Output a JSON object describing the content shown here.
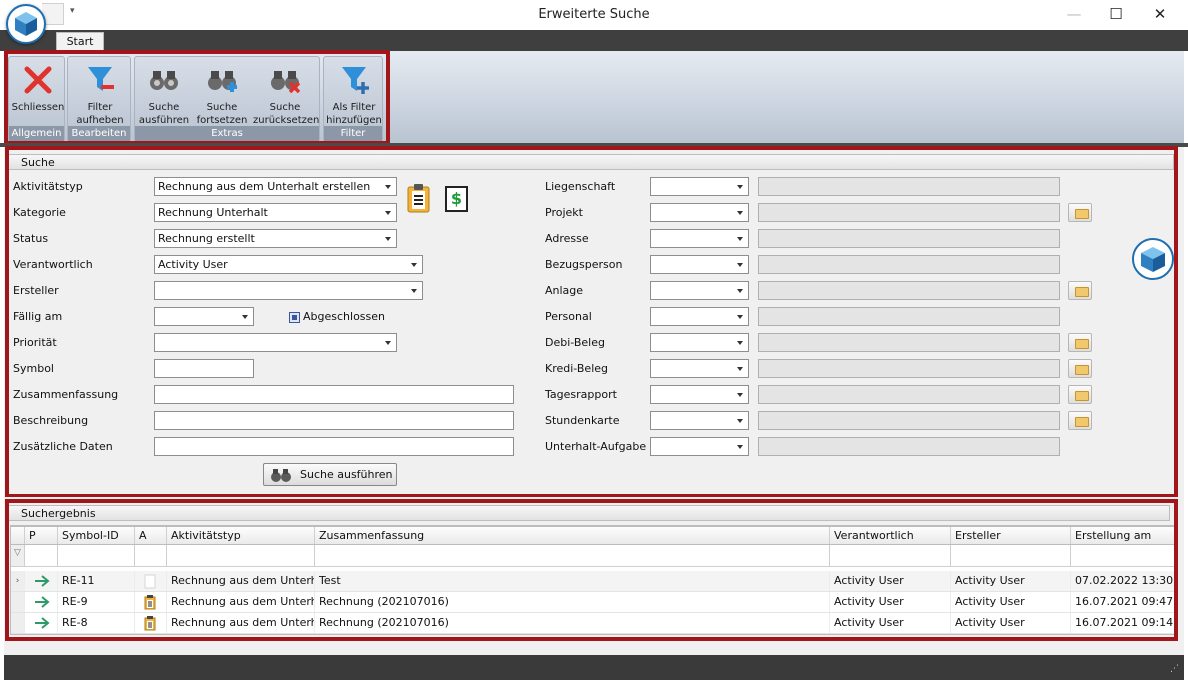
{
  "window": {
    "title": "Erweiterte Suche",
    "minimize": "—",
    "maximize": "☐",
    "close": "✕",
    "qat_dropdown": "▾"
  },
  "ribbon": {
    "tab": "Start",
    "groups": [
      {
        "caption": "Allgemein",
        "buttons": [
          {
            "label1": "Schliessen",
            "label2": "",
            "icon": "close-icon"
          }
        ]
      },
      {
        "caption": "Bearbeiten",
        "buttons": [
          {
            "label1": "Filter",
            "label2": "aufheben",
            "icon": "filter-remove-icon"
          }
        ]
      },
      {
        "caption": "Extras",
        "buttons": [
          {
            "label1": "Suche",
            "label2": "ausführen",
            "icon": "binoculars-icon"
          },
          {
            "label1": "Suche",
            "label2": "fortsetzen",
            "icon": "binoculars-plus-icon"
          },
          {
            "label1": "Suche",
            "label2": "zurücksetzen",
            "icon": "binoculars-x-icon"
          }
        ]
      },
      {
        "caption": "Filter",
        "buttons": [
          {
            "label1": "Als Filter",
            "label2": "hinzufügen",
            "icon": "filter-add-icon"
          }
        ]
      }
    ]
  },
  "suche": {
    "header": "Suche",
    "left": [
      {
        "label": "Aktivitätstyp",
        "value": "Rechnung aus dem Unterhalt erstellen"
      },
      {
        "label": "Kategorie",
        "value": "Rechnung Unterhalt"
      },
      {
        "label": "Status",
        "value": "Rechnung erstellt"
      },
      {
        "label": "Verantwortlich",
        "value": "Activity User"
      },
      {
        "label": "Ersteller",
        "value": ""
      },
      {
        "label": "Fällig am",
        "value": ""
      },
      {
        "label": "Priorität",
        "value": ""
      },
      {
        "label": "Symbol",
        "value": ""
      },
      {
        "label": "Zusammenfassung",
        "value": ""
      },
      {
        "label": "Beschreibung",
        "value": ""
      },
      {
        "label": "Zusätzliche Daten",
        "value": ""
      }
    ],
    "abgeschlossen_label": "Abgeschlossen",
    "dollar_symbol": "$",
    "right": [
      {
        "label": "Liegenschaft"
      },
      {
        "label": "Projekt"
      },
      {
        "label": "Adresse"
      },
      {
        "label": "Bezugsperson"
      },
      {
        "label": "Anlage"
      },
      {
        "label": "Personal"
      },
      {
        "label": "Debi-Beleg"
      },
      {
        "label": "Kredi-Beleg"
      },
      {
        "label": "Tagesrapport"
      },
      {
        "label": "Stundenkarte"
      },
      {
        "label": "Unterhalt-Aufgabe"
      }
    ],
    "search_button": "Suche ausführen"
  },
  "results": {
    "header": "Suchergebnis",
    "columns": [
      "P",
      "Symbol-ID",
      "A",
      "Aktivitätstyp",
      "Zusammenfassung",
      "Verantwortlich",
      "Ersteller",
      "Erstellung am"
    ],
    "rows": [
      {
        "symbol": "RE-11",
        "typ": "Rechnung aus dem Unterh...",
        "summary": "Test",
        "verantwortlich": "Activity User",
        "ersteller": "Activity User",
        "date": "07.02.2022 13:30"
      },
      {
        "symbol": "RE-9",
        "typ": "Rechnung aus dem Unterh...",
        "summary": "Rechnung (202107016)",
        "verantwortlich": "Activity User",
        "ersteller": "Activity User",
        "date": "16.07.2021 09:47"
      },
      {
        "symbol": "RE-8",
        "typ": "Rechnung aus dem Unterh...",
        "summary": "Rechnung (202107016)",
        "verantwortlich": "Activity User",
        "ersteller": "Activity User",
        "date": "16.07.2021 09:14"
      }
    ]
  },
  "colors": {
    "highlight": "#a1161b",
    "accent": "#1f6fb0",
    "ribbon_caption": "#8c98a8"
  }
}
